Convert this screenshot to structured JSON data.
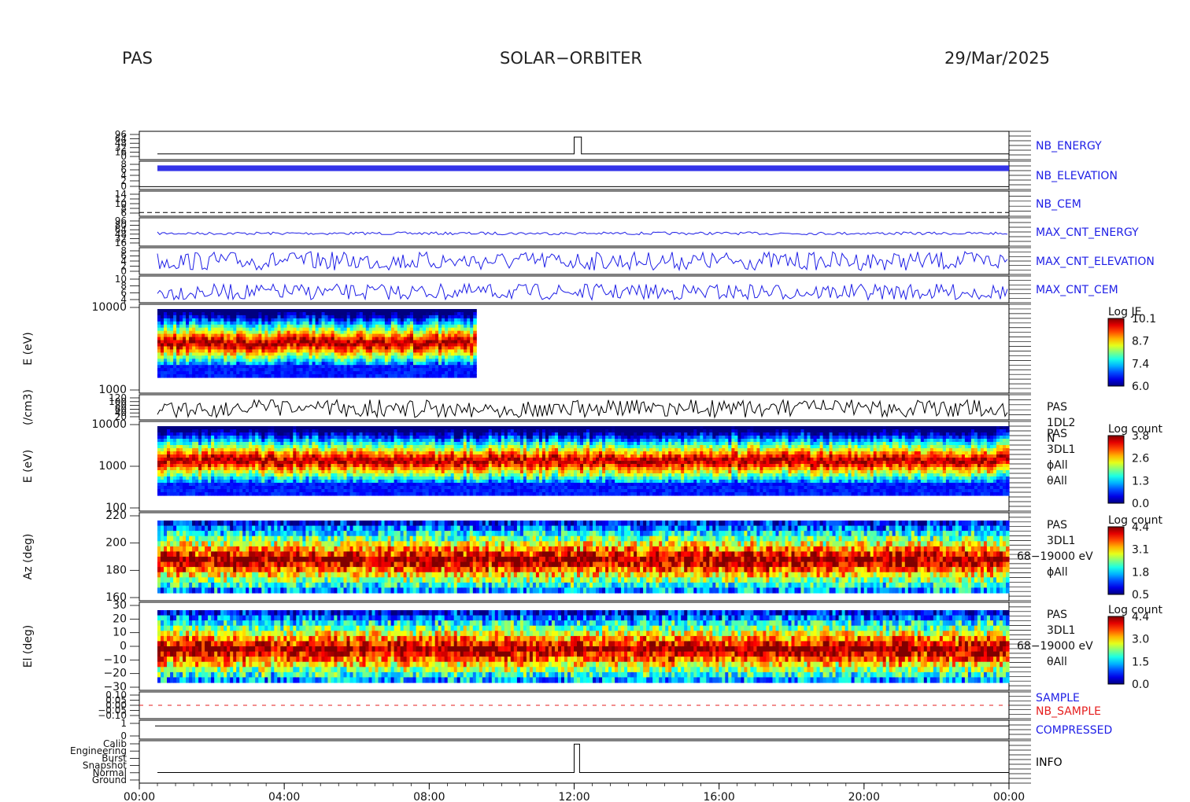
{
  "header": {
    "left": "PAS",
    "center": "SOLAR−ORBITER",
    "right": "29/Mar/2025"
  },
  "colors": {
    "blue": "#1e1ee6",
    "red": "#e61e1e",
    "black": "#000000"
  },
  "chart_data": {
    "type": "heatmap",
    "x_ticks": [
      "00:00",
      "04:00",
      "08:00",
      "12:00",
      "16:00",
      "20:00",
      "00:00"
    ],
    "x_range_hours": [
      0,
      24
    ],
    "panels": [
      {
        "id": "nb-energy",
        "label": "NB_ENERGY",
        "label_color": "blue",
        "y_ticks": [
          "96",
          "64",
          "48",
          "32",
          "16",
          "0"
        ],
        "kind": "trace",
        "line_color": "black",
        "y": [
          0.8,
          0.8,
          0.8,
          0.8,
          0.8,
          0.8,
          0.8,
          0.8,
          0.8,
          0.8,
          0.8,
          0.8,
          0.8,
          0.8,
          0.8,
          0.8,
          0.8,
          0.8,
          0.8,
          0.8,
          0.8,
          0.8,
          0.8,
          0.8
        ],
        "spike_hour": 12,
        "spike_y": 0.2
      },
      {
        "id": "nb-elevation",
        "label": "NB_ELEVATION",
        "label_color": "blue",
        "y_ticks": [
          "8",
          "6",
          "4",
          "2",
          "0"
        ],
        "kind": "dense",
        "line_color": "blue",
        "y": [
          0.15,
          0.2
        ]
      },
      {
        "id": "nb-cem",
        "label": "NB_CEM",
        "label_color": "blue",
        "y_ticks": [
          "14",
          "12",
          "10",
          "8",
          "6"
        ],
        "kind": "dashed",
        "line_color": "black",
        "y": [
          0.85
        ]
      },
      {
        "id": "max-cnt-energy",
        "label": "MAX_CNT_ENERGY",
        "label_color": "blue",
        "y_ticks": [
          "96",
          "80",
          "64",
          "48",
          "32",
          "16"
        ],
        "kind": "noise",
        "line_color": "blue",
        "y": [
          0.55,
          0.05
        ]
      },
      {
        "id": "max-cnt-elevation",
        "label": "MAX_CNT_ELEVATION",
        "label_color": "blue",
        "y_ticks": [
          "8",
          "6",
          "4",
          "2",
          "0"
        ],
        "kind": "noise",
        "line_color": "blue",
        "y": [
          0.5,
          0.35
        ]
      },
      {
        "id": "max-cnt-cem",
        "label": "MAX_CNT_CEM",
        "label_color": "blue",
        "y_ticks": [
          "10",
          "8",
          "6",
          "4"
        ],
        "kind": "noise",
        "line_color": "blue",
        "y": [
          0.6,
          0.3
        ]
      },
      {
        "id": "pas-1dl2",
        "ylabel": "E (eV)",
        "y_ticks": [
          "10000",
          "1000"
        ],
        "kind": "spectrogram",
        "x_end_hour": 9.3,
        "colorbar": {
          "title": "Log JE",
          "ticks": [
            "10.1",
            "8.7",
            "7.4",
            "6.0"
          ]
        }
      },
      {
        "id": "density",
        "ylabel": "(/cm3)",
        "y_ticks": [
          "120",
          "100",
          "80",
          "60",
          "40",
          "20"
        ],
        "kind": "noise",
        "line_color": "black",
        "y": [
          0.55,
          0.35
        ],
        "right_labels": [
          "PAS",
          "1DL2",
          "N"
        ]
      },
      {
        "id": "pas-3dl1-e",
        "ylabel": "E (eV)",
        "y_ticks": [
          "10000",
          "1000",
          "100"
        ],
        "kind": "spectrogram",
        "x_end_hour": 24,
        "colorbar": {
          "title": "Log count",
          "ticks": [
            "3.8",
            "2.6",
            "1.3",
            "0.0"
          ]
        },
        "right_labels": [
          "PAS",
          "3DL1",
          "ϕAll",
          "θAll"
        ]
      },
      {
        "id": "pas-3dl1-az",
        "ylabel": "Az (deg)",
        "y_ticks": [
          "220",
          "200",
          "180",
          "160"
        ],
        "kind": "angular",
        "x_end_hour": 24,
        "colorbar": {
          "title": "Log count",
          "ticks": [
            "4.4",
            "3.1",
            "1.8",
            "0.5"
          ]
        },
        "right_labels": [
          "PAS",
          "3DL1",
          "68−19000 eV",
          "ϕAll"
        ]
      },
      {
        "id": "pas-3dl1-el",
        "ylabel": "El (deg)",
        "y_ticks": [
          "30",
          "20",
          "10",
          "0",
          "−10",
          "−20",
          "−30"
        ],
        "kind": "angular",
        "x_end_hour": 24,
        "colorbar": {
          "title": "Log count",
          "ticks": [
            "4.4",
            "3.0",
            "1.5",
            "0.0"
          ]
        },
        "right_labels": [
          "PAS",
          "3DL1",
          "68−19000 eV",
          "θAll"
        ]
      },
      {
        "id": "sample",
        "y_ticks": [
          "0.10",
          "0.05",
          "0.00",
          "−0.05",
          "−0.10"
        ],
        "kind": "dashed-red",
        "labels": [
          {
            "text": "SAMPLE",
            "color": "blue"
          },
          {
            "text": "NB_SAMPLE",
            "color": "red"
          }
        ]
      },
      {
        "id": "compressed",
        "label": "COMPRESSED",
        "label_color": "blue",
        "y_ticks": [
          "1",
          "0"
        ],
        "kind": "flat",
        "line_color": "black"
      },
      {
        "id": "info",
        "label": "INFO",
        "label_color": "black",
        "y_ticks": [
          "Calib",
          "Engineering",
          "Burst",
          "Snapshot",
          "Normal",
          "Ground"
        ],
        "kind": "step",
        "line_color": "black"
      }
    ]
  }
}
